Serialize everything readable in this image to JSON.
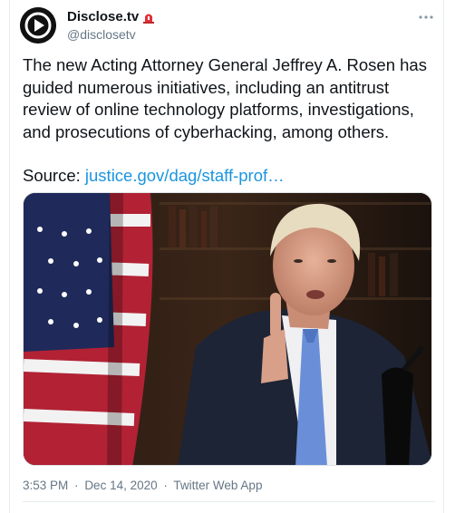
{
  "account": {
    "display_name": "Disclose.tv",
    "handle": "@disclosetv",
    "badge_icon": "police-light-icon"
  },
  "tweet": {
    "text": "The new Acting Attorney General Jeffrey A. Rosen has guided numerous initiatives, including an antitrust review of online technology platforms, investigations, and prosecutions of cyberhacking, among others.",
    "source_label": "Source:",
    "source_link": "justice.gov/dag/staff-prof…"
  },
  "meta": {
    "time": "3:53 PM",
    "separator": "·",
    "date": "Dec 14, 2020",
    "client": "Twitter Web App"
  },
  "colors": {
    "link": "#1b95e0",
    "muted": "#657786",
    "text": "#0f1419"
  }
}
